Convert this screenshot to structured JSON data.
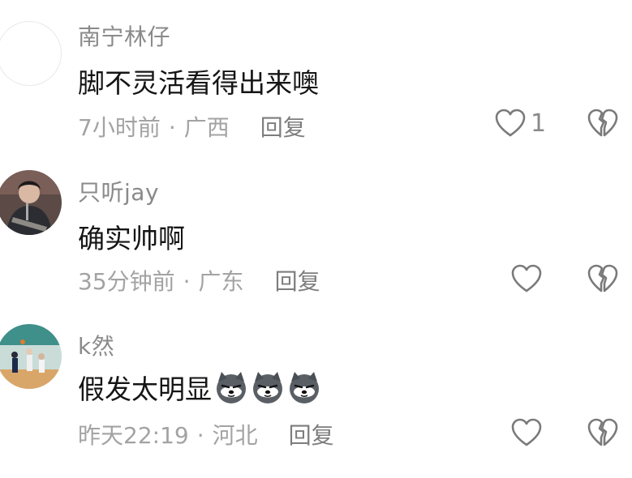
{
  "comments": [
    {
      "username": "南宁林仔",
      "text": "脚不灵活看得出来噢",
      "time": "7小时前",
      "separator": "·",
      "location": "广西",
      "reply_label": "回复",
      "likes": "1",
      "avatar": "blank-avatar"
    },
    {
      "username": "只听jay",
      "text": "确实帅啊",
      "time": "35分钟前",
      "separator": "·",
      "location": "广东",
      "reply_label": "回复",
      "likes": "",
      "avatar": "singer-with-guitar-photo"
    },
    {
      "username": "k然",
      "text": "假发太明显",
      "time": "昨天22:19",
      "separator": "·",
      "location": "河北",
      "reply_label": "回复",
      "likes": "",
      "avatar": "basketball-game-photo",
      "emojis": [
        "husky-dog-emoji",
        "husky-dog-emoji",
        "husky-dog-emoji"
      ]
    }
  ],
  "colors": {
    "username": "#8a8a8a",
    "text": "#151515",
    "meta": "#a3a3a3",
    "icon": "#7a7a7a"
  }
}
